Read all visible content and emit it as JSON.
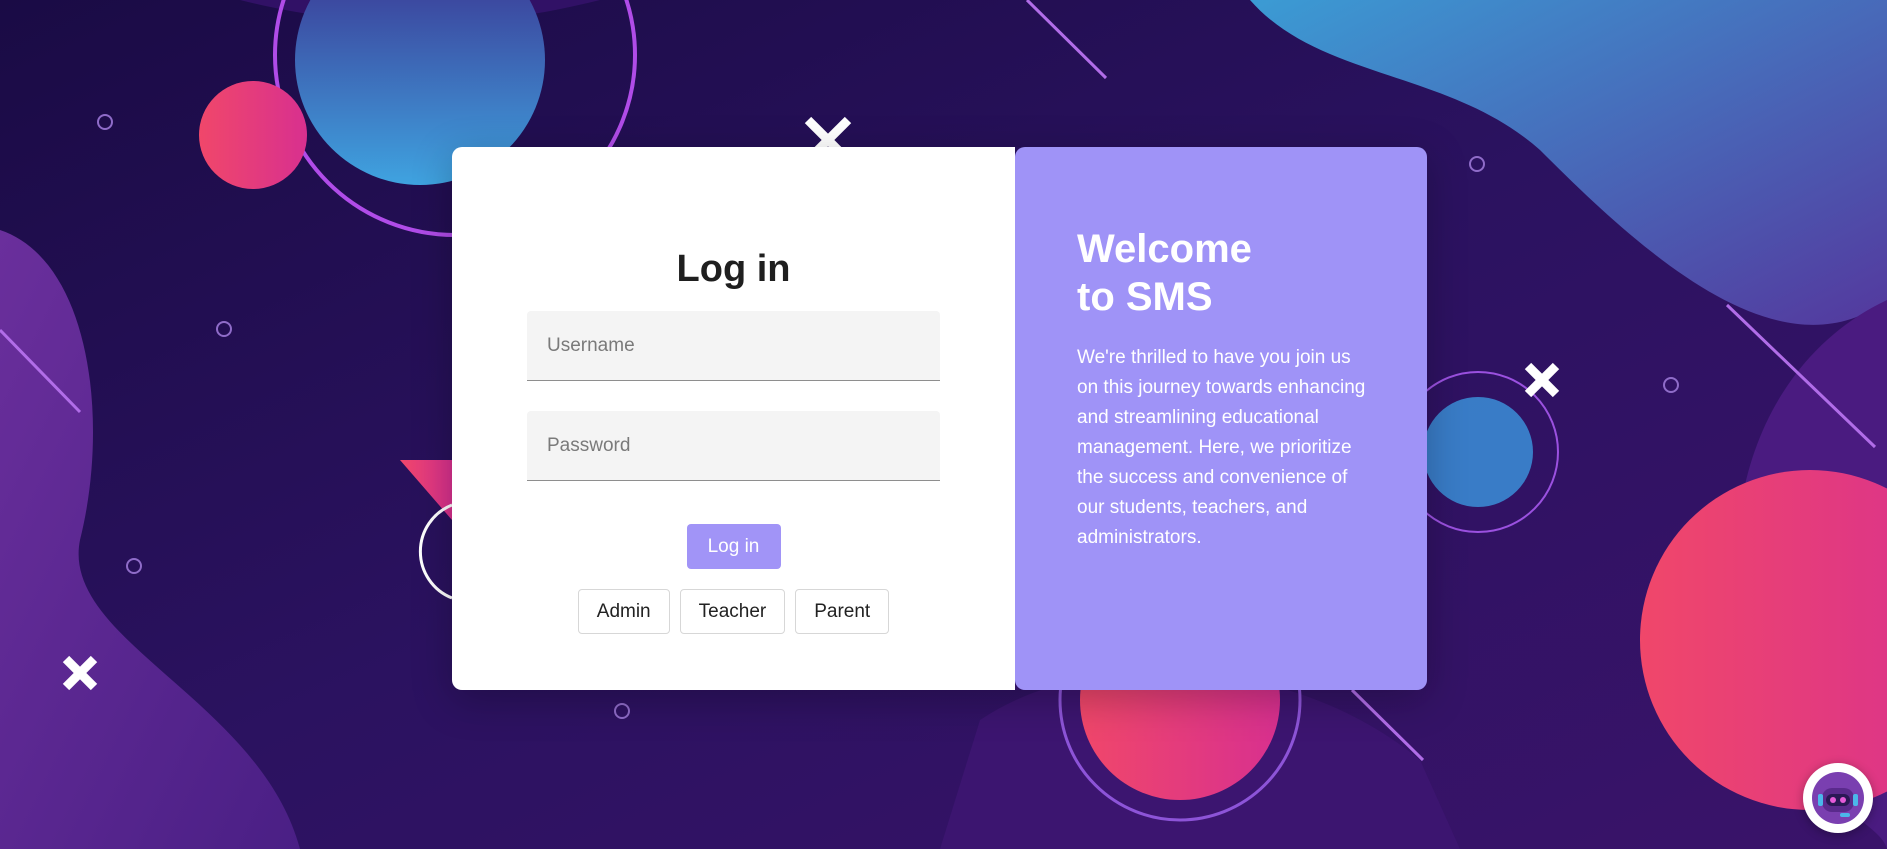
{
  "login": {
    "title": "Log in",
    "username_placeholder": "Username",
    "password_placeholder": "Password",
    "submit_label": "Log in",
    "roles": [
      "Admin",
      "Teacher",
      "Parent"
    ]
  },
  "welcome": {
    "title_line1": "Welcome",
    "title_line2": "to SMS",
    "text": "We're thrilled to have you join us on this journey towards enhancing and streamlining educational management. Here, we prioritize the success and convenience of our students, teachers, and administrators."
  },
  "chatbot": {
    "icon": "robot-icon"
  },
  "colors": {
    "accent": "#a194f7",
    "panel": "#9f93f7",
    "background": "#2a1155"
  }
}
